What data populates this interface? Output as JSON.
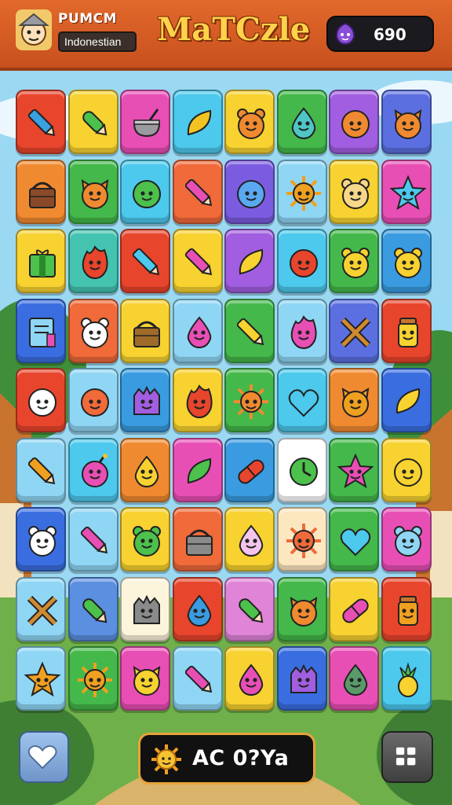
{
  "header": {
    "player_name": "PUMCM",
    "player_tag": "Indonestian",
    "title": "MaTCzle",
    "currency_value": "690",
    "currency_icon": "purple-gem-icon"
  },
  "footer": {
    "left_button_icon": "heart-icon",
    "status_icon": "sun-icon",
    "status_text": "AC 0?Ya",
    "right_button_icon": "grid-menu-icon"
  },
  "board": {
    "columns": 8,
    "rows": 9,
    "tiles": [
      {
        "bg": "#e8452d",
        "icon": "pencil-icon",
        "ic": "#3aa0e0"
      },
      {
        "bg": "#f7d230",
        "icon": "leaf-pencil-icon",
        "ic": "#4cc14c"
      },
      {
        "bg": "#e84fb5",
        "icon": "pot-icon",
        "ic": "#9a9aa0"
      },
      {
        "bg": "#4cc9ec",
        "icon": "leaf-icon",
        "ic": "#f2c422"
      },
      {
        "bg": "#f7d230",
        "icon": "bear-icon",
        "ic": "#f08a30"
      },
      {
        "bg": "#44b84a",
        "icon": "drop-face-icon",
        "ic": "#4fc6c6"
      },
      {
        "bg": "#a15ee0",
        "icon": "face-icon",
        "ic": "#f08a30"
      },
      {
        "bg": "#5b6fe0",
        "icon": "cat-icon",
        "ic": "#f08a30"
      },
      {
        "bg": "#f08a30",
        "icon": "basket-icon",
        "ic": "#8a4a2a"
      },
      {
        "bg": "#44b84a",
        "icon": "cat-icon",
        "ic": "#f08a30"
      },
      {
        "bg": "#4cc9ec",
        "icon": "face-icon",
        "ic": "#4cc14c"
      },
      {
        "bg": "#f06a3a",
        "icon": "pencil-icon",
        "ic": "#e84fb5"
      },
      {
        "bg": "#7b5ce0",
        "icon": "face-icon",
        "ic": "#5aa8f0"
      },
      {
        "bg": "#8fd6f4",
        "icon": "sun-icon",
        "ic": "#f0a020"
      },
      {
        "bg": "#f7d230",
        "icon": "bear-icon",
        "ic": "#f7d88a"
      },
      {
        "bg": "#e84fb5",
        "icon": "star-icon",
        "ic": "#4cc9ec"
      },
      {
        "bg": "#f7d230",
        "icon": "gift-icon",
        "ic": "#4cc14c"
      },
      {
        "bg": "#44c4b0",
        "icon": "flame-face-icon",
        "ic": "#e8452d"
      },
      {
        "bg": "#e8452d",
        "icon": "pencil-icon",
        "ic": "#4cc9ec"
      },
      {
        "bg": "#f7d230",
        "icon": "pencil-icon",
        "ic": "#e84fb5"
      },
      {
        "bg": "#a15ee0",
        "icon": "leaf-icon",
        "ic": "#f7d230"
      },
      {
        "bg": "#4cc9ec",
        "icon": "face-icon",
        "ic": "#e8452d"
      },
      {
        "bg": "#44b84a",
        "icon": "bear-icon",
        "ic": "#f7d230"
      },
      {
        "bg": "#3a9be0",
        "icon": "bear-icon",
        "ic": "#f7d230"
      },
      {
        "bg": "#3a6ee0",
        "icon": "book-icon",
        "ic": "#8fd6f4"
      },
      {
        "bg": "#f06a3a",
        "icon": "bear-icon",
        "ic": "#ffffff"
      },
      {
        "bg": "#f7d230",
        "icon": "basket-icon",
        "ic": "#a06a2a"
      },
      {
        "bg": "#8fd6f4",
        "icon": "drop-face-icon",
        "ic": "#e84fb5"
      },
      {
        "bg": "#44b84a",
        "icon": "pencil-icon",
        "ic": "#f7d230"
      },
      {
        "bg": "#8fd6f4",
        "icon": "flame-face-icon",
        "ic": "#e84fb5"
      },
      {
        "bg": "#5b6fe0",
        "icon": "cross-icon",
        "ic": "#d08a30"
      },
      {
        "bg": "#e8452d",
        "icon": "jar-icon",
        "ic": "#f7d230"
      },
      {
        "bg": "#e8452d",
        "icon": "face-icon",
        "ic": "#ffffff"
      },
      {
        "bg": "#8fd6f4",
        "icon": "face-icon",
        "ic": "#f06a3a"
      },
      {
        "bg": "#3a9be0",
        "icon": "monster-icon",
        "ic": "#a15ee0"
      },
      {
        "bg": "#f7d230",
        "icon": "flame-face-icon",
        "ic": "#e8452d"
      },
      {
        "bg": "#44b84a",
        "icon": "sun-icon",
        "ic": "#f08a30"
      },
      {
        "bg": "#4cc9ec",
        "icon": "heart-icon",
        "ic": "#4cc9ec"
      },
      {
        "bg": "#f08a30",
        "icon": "cat-icon",
        "ic": "#f0a020"
      },
      {
        "bg": "#3a6ee0",
        "icon": "leaf-icon",
        "ic": "#f7d230"
      },
      {
        "bg": "#8fd6f4",
        "icon": "pencil-icon",
        "ic": "#f0a020"
      },
      {
        "bg": "#4cc9ec",
        "icon": "bomb-face-icon",
        "ic": "#e84fb5"
      },
      {
        "bg": "#f08a30",
        "icon": "drop-face-icon",
        "ic": "#f7d230"
      },
      {
        "bg": "#e84fb5",
        "icon": "leaf-icon",
        "ic": "#4cc14c"
      },
      {
        "bg": "#3a9be0",
        "icon": "capsule-icon",
        "ic": "#e8452d"
      },
      {
        "bg": "#ffffff",
        "icon": "clock-icon",
        "ic": "#4cc14c"
      },
      {
        "bg": "#44b84a",
        "icon": "star-icon",
        "ic": "#e84fb5"
      },
      {
        "bg": "#f7d230",
        "icon": "face-icon",
        "ic": "#f7d230"
      },
      {
        "bg": "#3a6ee0",
        "icon": "bear-icon",
        "ic": "#ffffff"
      },
      {
        "bg": "#8fd6f4",
        "icon": "pencil-icon",
        "ic": "#e84fb5"
      },
      {
        "bg": "#f7d230",
        "icon": "bear-icon",
        "ic": "#4cc14c"
      },
      {
        "bg": "#f06a3a",
        "icon": "basket-icon",
        "ic": "#8a8a8a"
      },
      {
        "bg": "#f7d230",
        "icon": "drop-face-icon",
        "ic": "#f4c4ec"
      },
      {
        "bg": "#fde7c0",
        "icon": "sun-icon",
        "ic": "#f06a3a"
      },
      {
        "bg": "#44b84a",
        "icon": "heart-icon",
        "ic": "#4cc9ec"
      },
      {
        "bg": "#e84fb5",
        "icon": "bear-icon",
        "ic": "#8fd6f4"
      },
      {
        "bg": "#8fd6f4",
        "icon": "cross-icon",
        "ic": "#d08a30"
      },
      {
        "bg": "#5b8fe0",
        "icon": "leaf-pencil-icon",
        "ic": "#4cc14c"
      },
      {
        "bg": "#fdf4dc",
        "icon": "monster-icon",
        "ic": "#8a8a8a"
      },
      {
        "bg": "#e8452d",
        "icon": "drop-face-icon",
        "ic": "#3a9be0"
      },
      {
        "bg": "#e084d8",
        "icon": "leaf-pencil-icon",
        "ic": "#4cc14c"
      },
      {
        "bg": "#44b84a",
        "icon": "cat-icon",
        "ic": "#f08a30"
      },
      {
        "bg": "#f7d230",
        "icon": "capsule-icon",
        "ic": "#e84fb5"
      },
      {
        "bg": "#e8452d",
        "icon": "jar-icon",
        "ic": "#f0a020"
      },
      {
        "bg": "#8fd6f4",
        "icon": "star-icon",
        "ic": "#f0a020"
      },
      {
        "bg": "#44b84a",
        "icon": "sun-icon",
        "ic": "#f0a020"
      },
      {
        "bg": "#e84fb5",
        "icon": "cat-icon",
        "ic": "#f7d230"
      },
      {
        "bg": "#8fd6f4",
        "icon": "pencil-icon",
        "ic": "#e84fb5"
      },
      {
        "bg": "#f7d230",
        "icon": "drop-face-icon",
        "ic": "#e84fb5"
      },
      {
        "bg": "#3a6ee0",
        "icon": "monster-icon",
        "ic": "#a15ee0"
      },
      {
        "bg": "#e84fb5",
        "icon": "drop-face-icon",
        "ic": "#5a9a6a"
      },
      {
        "bg": "#4cc9ec",
        "icon": "pineapple-icon",
        "ic": "#f7d230"
      }
    ]
  }
}
